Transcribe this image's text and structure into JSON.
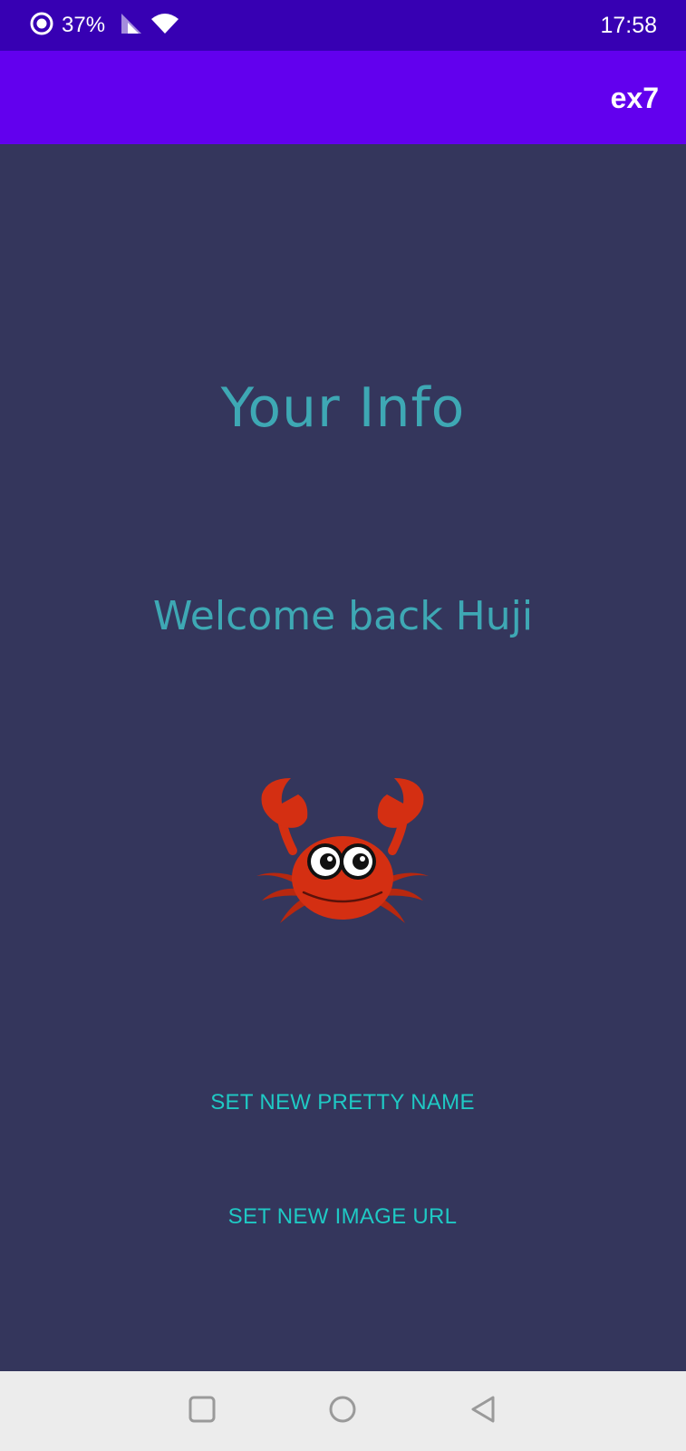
{
  "status_bar": {
    "battery_percent": "37%",
    "time": "17:58"
  },
  "app_bar": {
    "title": "ex7"
  },
  "content": {
    "heading": "Your Info",
    "welcome": "Welcome back Huji",
    "image": "crab-image"
  },
  "actions": {
    "set_name_label": "SET NEW PRETTY NAME",
    "set_image_label": "SET NEW IMAGE URL"
  },
  "nav_bar": {
    "recents": "square-icon",
    "home": "circle-icon",
    "back": "triangle-back-icon"
  },
  "colors": {
    "status_bar": "#3700b3",
    "app_bar": "#6200ee",
    "background": "#34365c",
    "heading_text": "#3ea8b4",
    "button_text": "#1fc9c4",
    "crab": "#d42f12"
  }
}
